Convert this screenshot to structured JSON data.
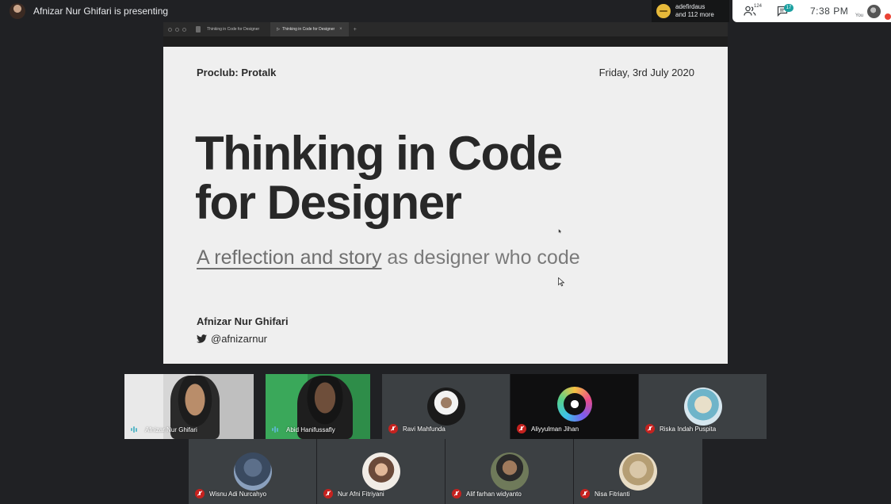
{
  "presenter": {
    "text": "Afnizar Nur Ghifari is presenting"
  },
  "joined": {
    "line1": "adefirdaus",
    "line2": "and 112 more"
  },
  "toolbar": {
    "people_count": "124",
    "chat_badge": "17",
    "time": "7:38  PM",
    "you_label": "You"
  },
  "browser": {
    "tabs": [
      {
        "label": "Thinking in Code for Designer",
        "active": false
      },
      {
        "label": "Thinking in Code for Designer",
        "active": true
      }
    ],
    "close_glyph": "×",
    "add_glyph": "+",
    "play_glyph": "▷"
  },
  "slide": {
    "event": "Proclub: Protalk",
    "date": "Friday, 3rd July 2020",
    "title_line1": "Thinking in Code",
    "title_line2": "for Designer",
    "subtitle_underlined": "A reflection and story",
    "subtitle_rest": " as designer who code",
    "author": "Afnizar Nur Ghifari",
    "handle": "@afnizarnur"
  },
  "participants": [
    {
      "name": "Afnizar Nur Ghifari",
      "state": "speaking"
    },
    {
      "name": "Abid Hanifussafly",
      "state": "speaking"
    },
    {
      "name": "Ravi Mahfunda",
      "state": "muted"
    },
    {
      "name": "Aliyyulman Jihan",
      "state": "muted"
    },
    {
      "name": "Riska Indah Puspita",
      "state": "muted"
    },
    {
      "name": "Wisnu Adi Nurcahyo",
      "state": "muted"
    },
    {
      "name": "Nur Afni Fitriyani",
      "state": "muted"
    },
    {
      "name": "Alif farhan widyanto",
      "state": "muted"
    },
    {
      "name": "Nisa Fitrianti",
      "state": "muted"
    }
  ],
  "colors": {
    "background": "#202124",
    "tile": "#3c4043",
    "mute": "#c5221f",
    "chat_badge": "#1a9fa0",
    "slide_bg": "#efefef"
  }
}
